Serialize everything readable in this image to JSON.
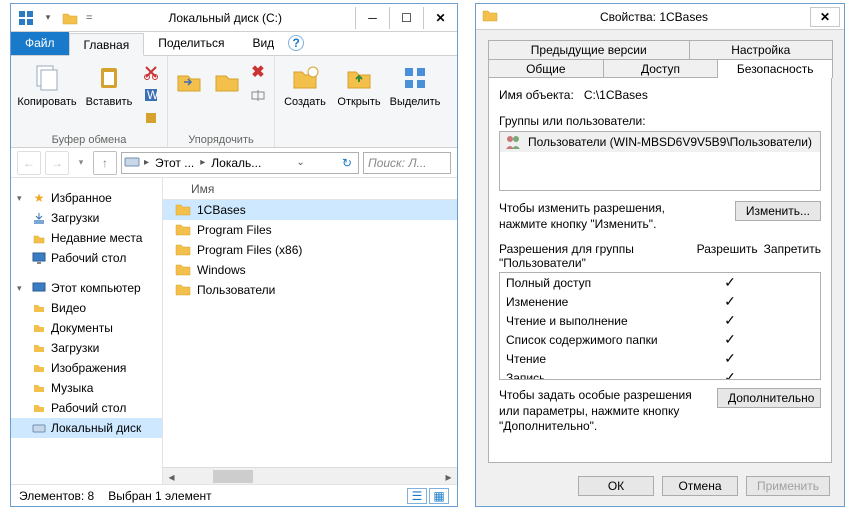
{
  "explorer": {
    "title": "Локальный диск (C:)",
    "tabs": {
      "file": "Файл",
      "home": "Главная",
      "share": "Поделиться",
      "view": "Вид"
    },
    "ribbon": {
      "clipboard_group": "Буфер обмена",
      "organize_group": "Упорядочить",
      "copy": "Копировать",
      "paste": "Вставить",
      "new": "Создать",
      "open": "Открыть",
      "select": "Выделить"
    },
    "breadcrumb": {
      "pc": "Этот ...",
      "drive": "Локаль..."
    },
    "search_placeholder": "Поиск: Л...",
    "nav": {
      "favorites": "Избранное",
      "downloads": "Загрузки",
      "recent": "Недавние места",
      "desktop": "Рабочий стол",
      "this_pc": "Этот компьютер",
      "videos": "Видео",
      "documents": "Документы",
      "downloads2": "Загрузки",
      "pictures": "Изображения",
      "music": "Музыка",
      "desktop2": "Рабочий стол",
      "localdisk": "Локальный диск"
    },
    "column_name": "Имя",
    "files": [
      {
        "name": "1CBases",
        "selected": true
      },
      {
        "name": "Program Files",
        "selected": false
      },
      {
        "name": "Program Files (x86)",
        "selected": false
      },
      {
        "name": "Windows",
        "selected": false
      },
      {
        "name": "Пользователи",
        "selected": false
      }
    ],
    "status": {
      "count": "Элементов: 8",
      "selected": "Выбран 1 элемент"
    }
  },
  "props": {
    "title": "Свойства: 1CBases",
    "tabs": {
      "prev": "Предыдущие версии",
      "custom": "Настройка",
      "general": "Общие",
      "sharing": "Доступ",
      "security": "Безопасность"
    },
    "object_label": "Имя объекта:",
    "object_path": "C:\\1CBases",
    "groups_label": "Группы или пользователи:",
    "group_entry": "Пользователи (WIN-MBSD6V9V5B9\\Пользователи)",
    "edit_hint": "Чтобы изменить разрешения, нажмите кнопку \"Изменить\".",
    "edit_btn": "Изменить...",
    "perm_for": "Разрешения для группы \"Пользователи\"",
    "allow": "Разрешить",
    "deny": "Запретить",
    "perms": [
      {
        "name": "Полный доступ",
        "allow": true,
        "deny": false
      },
      {
        "name": "Изменение",
        "allow": true,
        "deny": false
      },
      {
        "name": "Чтение и выполнение",
        "allow": true,
        "deny": false
      },
      {
        "name": "Список содержимого папки",
        "allow": true,
        "deny": false
      },
      {
        "name": "Чтение",
        "allow": true,
        "deny": false
      },
      {
        "name": "Запись",
        "allow": true,
        "deny": false
      }
    ],
    "adv_hint": "Чтобы задать особые разрешения или параметры, нажмите кнопку \"Дополнительно\".",
    "adv_btn": "Дополнительно",
    "ok": "ОК",
    "cancel": "Отмена",
    "apply": "Применить"
  }
}
